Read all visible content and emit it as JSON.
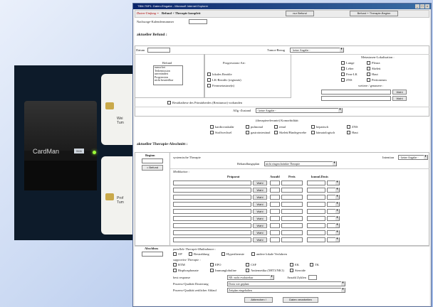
{
  "window": {
    "title": "TBM-TBP1: Daten-Eingabe - Microsoft Internet Explorer"
  },
  "photo": {
    "device_label": "CardMan",
    "device_badge": "3111",
    "card1_text": [
      "Wei",
      "Tum"
    ],
    "card2_text": [
      "Prof",
      "Tum"
    ]
  },
  "header": {
    "scope_label": "Daten-Umfang =",
    "scope_value": "Befund + Therapie komplett",
    "btn_only_befund": "nur Befund",
    "btn_befund_therapie": "Befund + Therapie-Beginn",
    "followup_label": "Nachsorge-Kalendernummer"
  },
  "befund": {
    "section_title": "aktueller Befund :",
    "datum_label": "Datum",
    "tumor_bezug_label": "Tumor-Bezug",
    "tumor_bezug_value": "- keine Angabe -",
    "befund_label": "Befund",
    "befund_options": [
      "tumorfrei",
      "Teilremission",
      "unverändert",
      "Progression",
      "nicht beurteilbar"
    ],
    "progression_title": "Progressions-Art:",
    "progression_options": [
      "lokales Rezidiv",
      "LK-Rezidiv (regionär)",
      "Fernmetastase(n)"
    ],
    "meta_title": "Metastasen-Lokalisation :",
    "meta_options": [
      [
        "Lunge",
        "Pleura"
      ],
      [
        "Leber",
        "Skelett"
      ],
      [
        "Fern-LK",
        "Haut"
      ],
      [
        "ZNS",
        "Peritoneum"
      ]
    ],
    "meta_more_label": "weitere / genauere :",
    "wahl": "Wahl",
    "residual_label": "Restdiathese des Primärherdes (Resttumor) vorhanden",
    "allg_zustand_label": "Allg.-Zustand",
    "allg_zustand_value": "- keine Angabe -",
    "komorb_title": "(therapierelevante) Komorbidität:",
    "komorb_options": [
      [
        "kardiovaskulär",
        "pulmonal",
        "renal",
        "hepatisch",
        "ZNS"
      ],
      [
        "Stoffwechsel",
        "gastrointestinal",
        "Skelett/Bindegewebe",
        "hämatologisch",
        "Haut"
      ]
    ]
  },
  "therapie": {
    "section_title": "aktueller Therapie-Abschnitt :",
    "beginn_label": "Beginn",
    "befund_btn": "= Befund",
    "systemic_label": "systemische Therapie",
    "intention_label": "Intention",
    "intention_value": "- keine Angabe -",
    "plan_label": "Behandlungsplan",
    "plan_value": "nicht eingeschränkte Therapie",
    "medikation_label": "Medikation :",
    "col_praeparat": "Präparat",
    "col_anzahl": "Anzahl",
    "col_preis": "Preis",
    "col_dosis": "kumul.Dosis",
    "med_row_count_label": "9",
    "abschluss_label": "Abschluss",
    "parallel_label": "parallele Therapie-Maßnahmen :",
    "parallel_options": [
      "OP",
      "Bestrahlung",
      "Hyperthermie",
      "andere lokale Verfahren"
    ],
    "supportive_label": "supportive Therapie :",
    "supportive_row1": [
      "BTM",
      "EPO",
      "CSF",
      "EK",
      "TK"
    ],
    "supportive_row2": [
      "Bisphosphonate",
      "Immunglobuline",
      "Antiemetika (5HT3/NK1)",
      "Steroide"
    ],
    "best_response_label": "best response",
    "best_response_value": "NE: nicht evaluierbar",
    "anzahl_zyklen_label": "Anzahl Zyklen",
    "dosing_label": "Prozess-Qualität Dosierung",
    "dosing_value": "Dosis wie geplant",
    "time_label": "Prozess-Qualität zeitlicher Ablauf",
    "time_value": "Zeitplan eingehalten"
  },
  "footer": {
    "cancel_btn": "Abbrechen !",
    "process_btn": "Daten verarbeiten"
  }
}
